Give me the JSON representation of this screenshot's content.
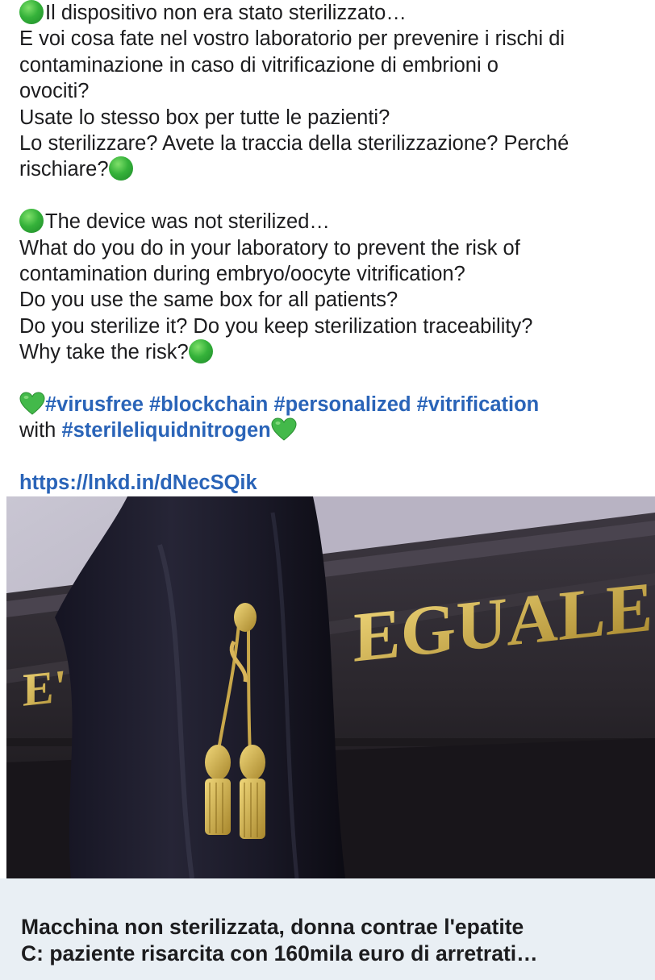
{
  "post": {
    "it_lines": [
      "Il dispositivo non era stato sterilizzato…",
      "E voi cosa fate nel vostro laboratorio per prevenire i rischi di",
      "contaminazione in caso di vitrificazione di embrioni o",
      "ovociti?",
      "Usate lo stesso box per tutte le pazienti?",
      "Lo sterilizzare? Avete la traccia della sterilizzazione? Perché",
      "rischiare?"
    ],
    "en_lines": [
      "The device was not sterilized…",
      "What do you do in your laboratory to prevent the risk of",
      "contamination during embryo/oocyte vitrification?",
      "Do you use the same box for all patients?",
      "Do you sterilize it? Do you keep sterilization traceability?",
      "Why take the risk?"
    ],
    "hashtags_line1": "#virusfree #blockchain #personalized #vitrification",
    "hashtags_with": "with ",
    "hashtags_line2": "#sterileliquidnitrogen",
    "link": "https://lnkd.in/dNecSQik",
    "emoji_circle": "green-circle-icon",
    "emoji_heart": "green-heart-icon"
  },
  "card": {
    "image_text": "EGUALE",
    "image_text_small": "E'",
    "title_line1": "Macchina non sterilizzata, donna contrae l'epatite",
    "title_line2": "C: paziente risarcita con 160mila euro di arretrati…"
  },
  "colors": {
    "hashtag": "#2a64b8",
    "emoji_green": "#35b23a",
    "card_footer_bg": "#e9eff4"
  }
}
